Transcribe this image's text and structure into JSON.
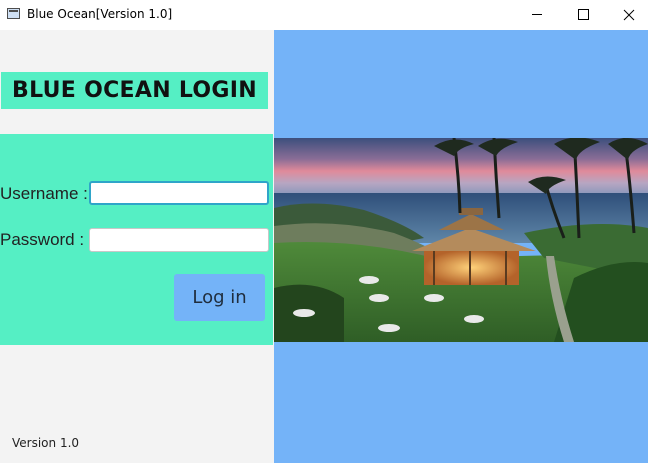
{
  "window": {
    "title": "Blue Ocean[Version 1.0]",
    "controls": [
      "minimize",
      "maximize",
      "close"
    ]
  },
  "login": {
    "heading": "BLUE OCEAN LOGIN",
    "username_label": "Username :",
    "username_value": "",
    "password_label": "Password :",
    "password_value": "",
    "login_button": "Log in"
  },
  "footer": {
    "version": "Version 1.0"
  },
  "colors": {
    "accent_green": "#55efc4",
    "accent_blue": "#74b3f8",
    "background": "#f3f3f3"
  },
  "image": {
    "subject": "tropical resort gazebo by the ocean at dusk with palm trees"
  }
}
